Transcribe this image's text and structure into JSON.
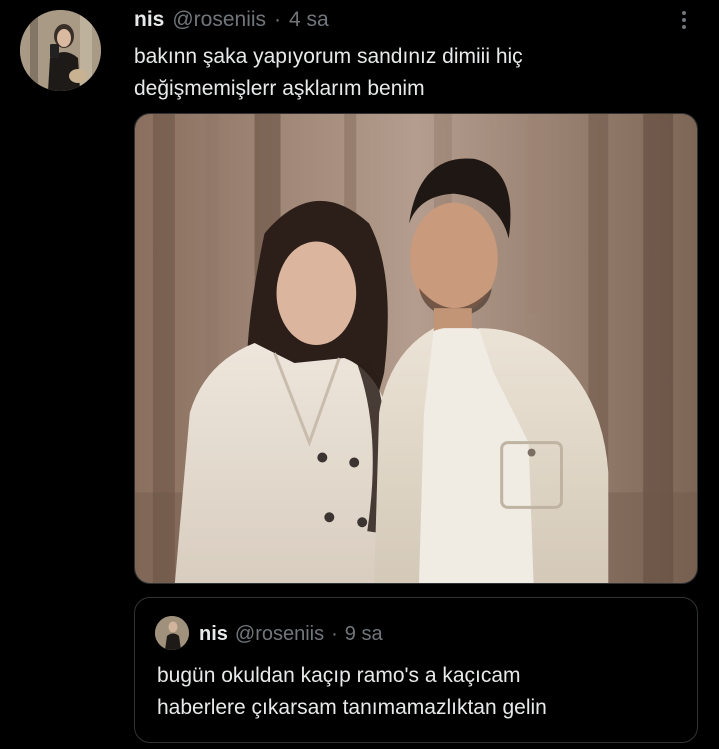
{
  "tweet": {
    "author_name": "nis",
    "author_handle": "@roseniis",
    "separator": "·",
    "time": "4 sa",
    "text_line1": "bakınn şaka yapıyorum sandınız dimiii hiç",
    "text_line2": "değişmemişlerr aşklarım benim",
    "more_icon": "more-vertical-icon"
  },
  "quoted": {
    "author_name": "nis",
    "author_handle": "@roseniis",
    "separator": "·",
    "time": "9 sa",
    "text_line1": "bugün okuldan kaçıp ramo's a kaçıcam",
    "text_line2": "haberlere çıkarsam tanımamazlıktan gelin"
  },
  "colors": {
    "background": "#000000",
    "primary_text": "#e7e9ea",
    "secondary_text": "#71767b",
    "border": "#2f3336"
  }
}
